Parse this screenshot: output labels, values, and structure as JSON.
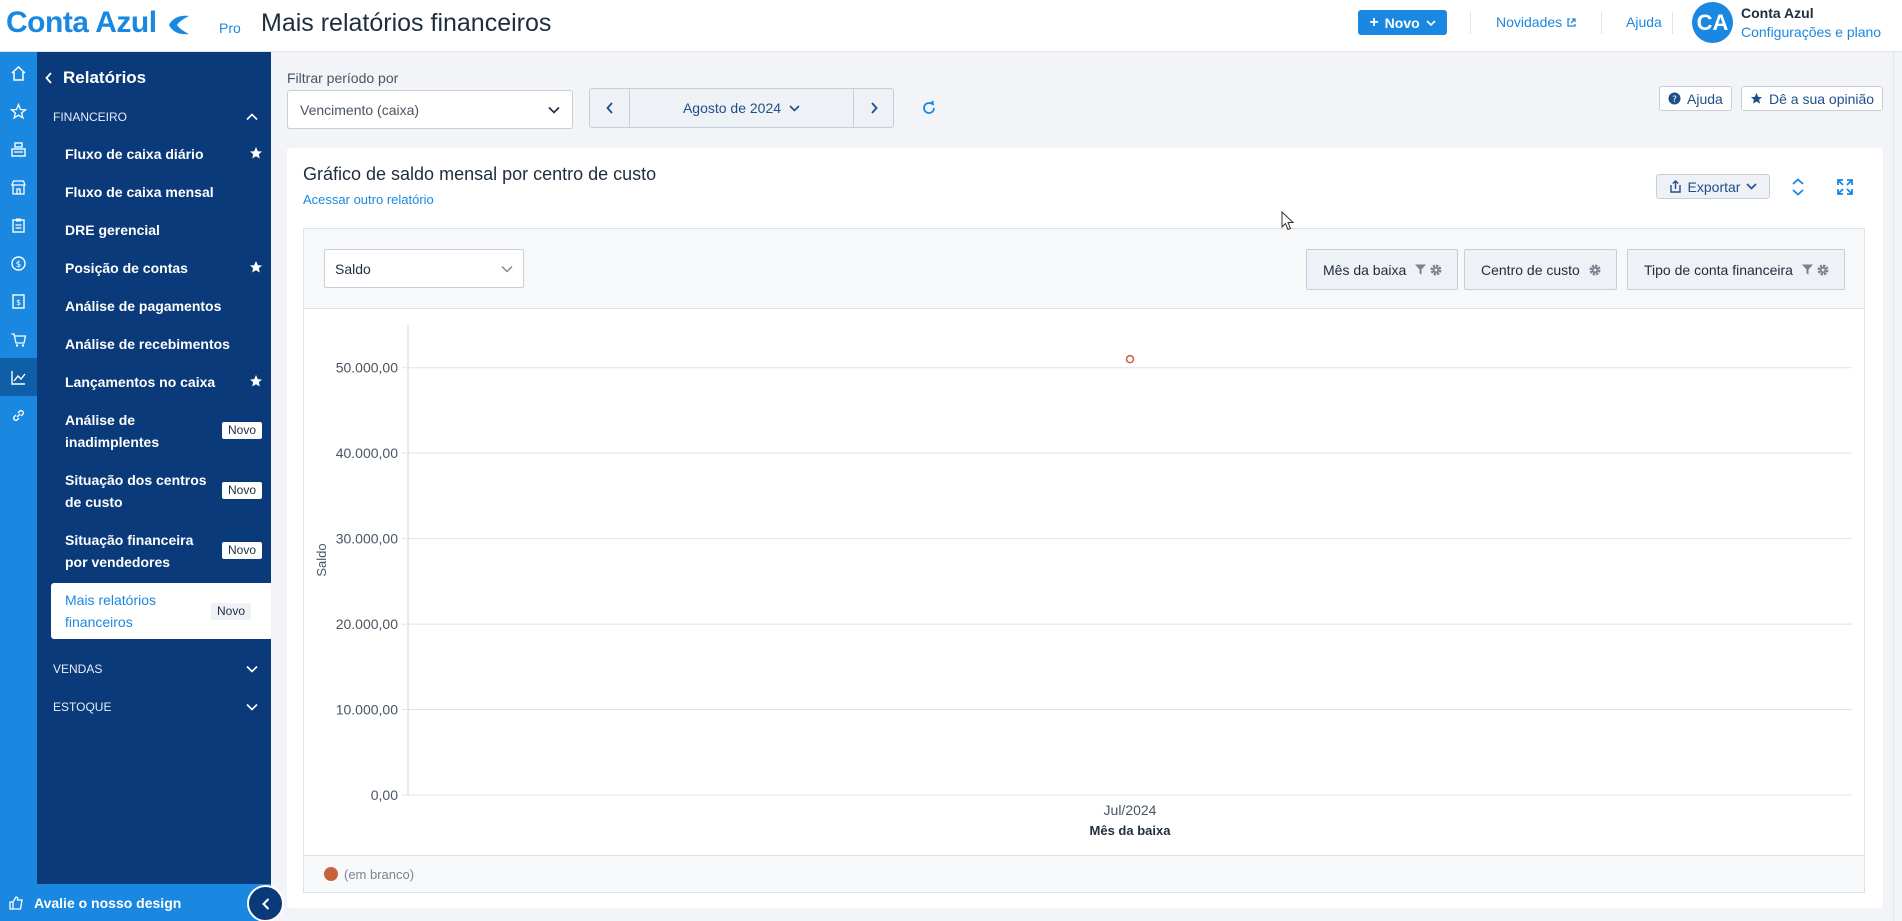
{
  "header": {
    "logo_text": "Conta Azul",
    "logo_tier": "Pro",
    "page_title": "Mais relatórios financeiros",
    "new_button": "Novo",
    "news_link": "Novidades",
    "help_link": "Ajuda",
    "avatar_initials": "CA",
    "account_name": "Conta Azul",
    "account_sub": "Configurações e plano"
  },
  "sidebar": {
    "title": "Relatórios",
    "sections": {
      "financeiro": "FINANCEIRO",
      "vendas": "VENDAS",
      "estoque": "ESTOQUE"
    },
    "items": [
      {
        "label": "Fluxo de caixa diário",
        "starred": true
      },
      {
        "label": "Fluxo de caixa mensal"
      },
      {
        "label": "DRE gerencial"
      },
      {
        "label": "Posição de contas",
        "starred": true
      },
      {
        "label": "Análise de pagamentos"
      },
      {
        "label": "Análise de recebimentos"
      },
      {
        "label": "Lançamentos no caixa",
        "starred": true
      },
      {
        "label_line1": "Análise de",
        "label_line2": "inadimplentes",
        "badge": "Novo"
      },
      {
        "label_line1": "Situação dos centros",
        "label_line2": "de custo",
        "badge": "Novo"
      },
      {
        "label_line1": "Situação financeira",
        "label_line2": "por vendedores",
        "badge": "Novo"
      },
      {
        "label_line1": "Mais relatórios",
        "label_line2": "financeiros",
        "badge": "Novo",
        "active": true
      }
    ],
    "footer_label": "Avalie o nosso design"
  },
  "filters": {
    "label": "Filtrar período por",
    "period_type": "Vencimento (caixa)",
    "period": "Agosto de 2024"
  },
  "top_actions": {
    "help": "Ajuda",
    "feedback": "Dê a sua opinião"
  },
  "report": {
    "title": "Gráfico de saldo mensal por centro de custo",
    "other_report_link": "Acessar outro relatório",
    "export_label": "Exportar",
    "measure": "Saldo",
    "dimensions": [
      "Mês da baixa",
      "Centro de custo",
      "Tipo de conta financeira"
    ]
  },
  "colors": {
    "brand": "#1a88e0",
    "sidebar_bg": "#0b3a7a",
    "series": "#c8623a"
  },
  "chart_data": {
    "type": "line",
    "x": [
      "Jul/2024"
    ],
    "series": [
      {
        "name": "(em branco)",
        "values": [
          51000
        ]
      }
    ],
    "xlabel": "Mês da baixa",
    "ylabel": "Saldo",
    "ylim": [
      0,
      55000
    ],
    "yticks": [
      0,
      10000,
      20000,
      30000,
      40000,
      50000
    ],
    "ytick_labels": [
      "0,00",
      "10.000,00",
      "20.000,00",
      "30.000,00",
      "40.000,00",
      "50.000,00"
    ],
    "grid": true,
    "legend": "bottom-left"
  }
}
